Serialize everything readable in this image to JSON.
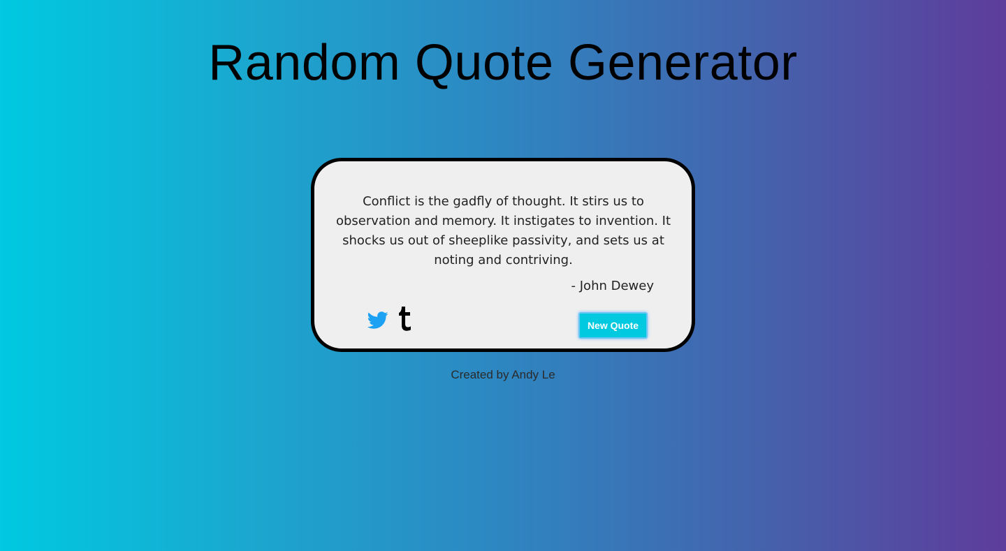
{
  "header": {
    "title": "Random Quote Generator"
  },
  "quote": {
    "text": "Conflict is the gadfly of thought. It stirs us to observation and memory. It instigates to invention. It shocks us out of sheeplike passivity, and sets us at noting and contriving.",
    "author": "- John Dewey"
  },
  "actions": {
    "twitter_icon": "twitter-icon",
    "tumblr_icon": "tumblr-icon",
    "new_quote_label": "New Quote"
  },
  "footer": {
    "credit": "Created by Andy Le"
  },
  "colors": {
    "gradient_start": "#00c9e0",
    "gradient_end": "#5e3c9c",
    "card_background": "#efefef",
    "button_background": "#00c9e0",
    "twitter_blue": "#1da1f2"
  }
}
